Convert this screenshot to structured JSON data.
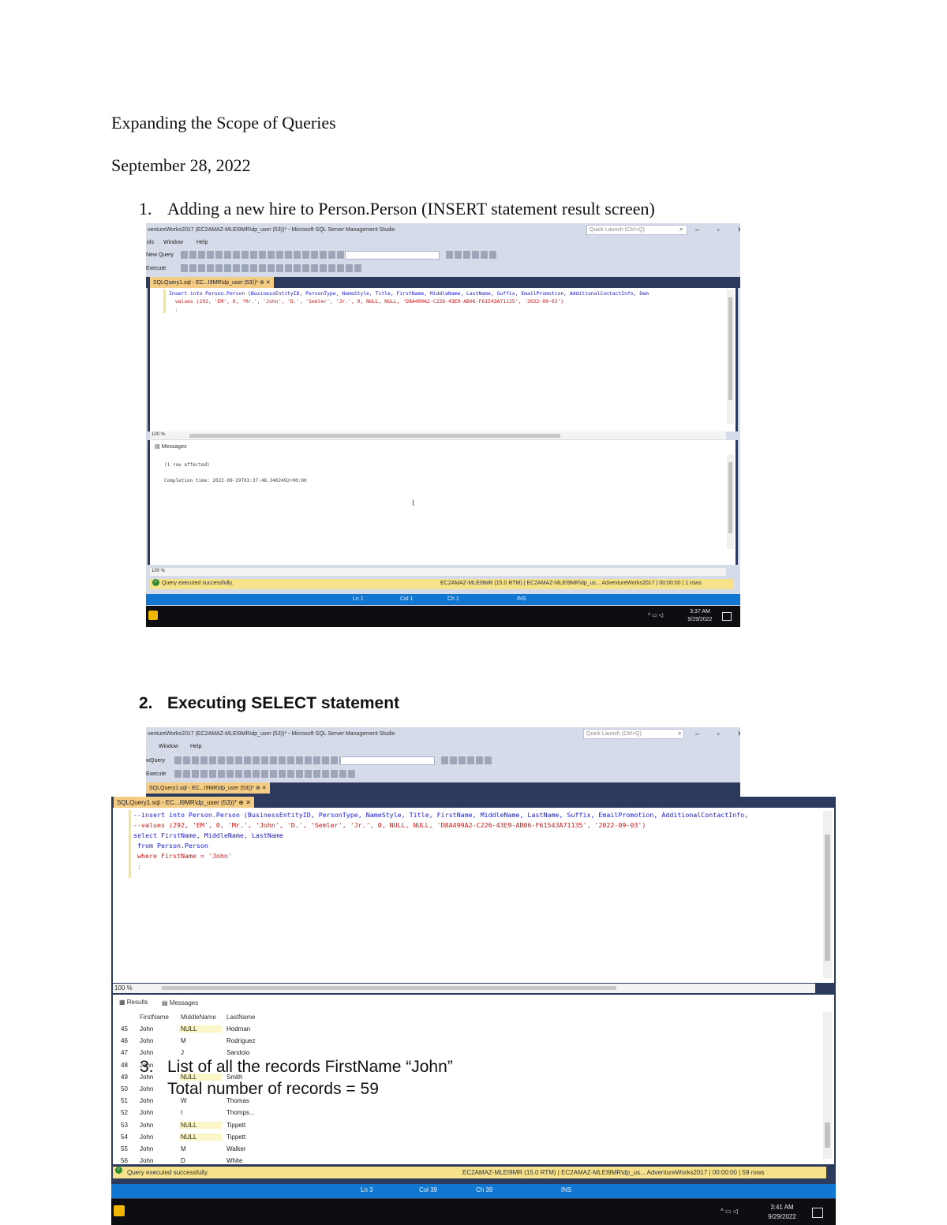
{
  "document": {
    "title": "Expanding the Scope of Queries",
    "date": "September 28, 2022",
    "item1": {
      "number": "1.",
      "text": "Adding a new hire to Person.Person (INSERT statement result screen)"
    },
    "item2": {
      "number": "2.",
      "text": "Executing SELECT statement"
    },
    "item3": {
      "number": "3.",
      "line1": "List of all the records FirstName “John”",
      "line2": "Total number of records = 59"
    }
  },
  "shot1": {
    "window_title": "ventureWorks2017 (EC2AMAZ-MLEI9MR\\dp_user (53))* - Microsoft SQL Server Management Studio",
    "quick_launch": "Quick Launch (Ctrl+Q)",
    "window_controls": "– ▫ ✕",
    "menu": [
      "ols",
      "Window",
      "Help"
    ],
    "toolbar1_label": "New Query",
    "toolbar2_label": "Execute",
    "tab": "SQLQuery1.sql - EC...I9MR\\dp_user (53))*  ⊕ ✕",
    "code": [
      "Insert into Person.Person (BusinessEntityID, PersonType, NameStyle, Title, FirstName, MiddleName, LastName, Suffix, EmailPromotion, AdditionalContactInfo, Dem",
      "  values (292, 'EM', 0, 'Mr.', 'John', 'D.', 'Semler', 'Jr.', 0, NULL, NULL, 'D8A499A2-C226-43E9-AB06-F61543A71135', '2022-09-03')",
      "  ;"
    ],
    "zoom": "100 %",
    "messages_tab": "Messages",
    "messages": [
      "(1 row affected)",
      "Completion time: 2022-09-29T03:37:48.3402492+00:00"
    ],
    "status_msg": "Query executed successfully.",
    "status_right": "EC2AMAZ-MLEI9MR (15.0 RTM)  | EC2AMAZ-MLEI9MR\\dp_us...  AdventureWorks2017  | 00:00:00 | 1 rows",
    "bluebar": {
      "ln": "Ln 1",
      "col": "Col 1",
      "ch": "Ch 1",
      "ins": "INS"
    },
    "clock_time": "3:37 AM",
    "clock_date": "9/29/2022"
  },
  "shot2": {
    "window_title": "ventureWorks2017 (EC2AMAZ-MLEI9MR\\dp_user (53))* - Microsoft SQL Server Management Studio",
    "quick_launch": "Quick Launch (Ctrl+Q)",
    "window_controls": "– ▫ ✕",
    "menu": [
      "",
      "Window",
      "Help"
    ],
    "toolbar1_label": "wQuery",
    "toolbar2_label": "Execute",
    "tab_back": "SQLQuery1.sql - EC...I9MR\\dp_user (53))*  ⊕ ✕",
    "tab_front": "SQLQuery1.sql - EC...I9MR\\dp_user (53))*  ⊕ ✕",
    "code": [
      "--insert into Person.Person (BusinessEntityID, PersonType, NameStyle, Title, FirstName, MiddleName, LastName, Suffix, EmailPromotion, AdditionalContactInfo,",
      "--values (292, 'EM', 0, 'Mr.', 'John', 'D.', 'Semler', 'Jr.', 0, NULL, NULL, 'D8A499A2-C226-43E9-AB06-F61543A71135', '2022-09-03')",
      "select FirstName, MiddleName, LastName",
      " from Person.Person",
      " where FirstName = 'John'",
      " ;"
    ],
    "zoom": "100 %",
    "results_tab": "Results",
    "messages_tab": "Messages",
    "columns": [
      "FirstName",
      "MiddleName",
      "LastName"
    ],
    "rows": [
      {
        "n": "45",
        "first": "John",
        "middle": "NULL",
        "last": "Hodman"
      },
      {
        "n": "46",
        "first": "John",
        "middle": "M",
        "last": "Rodriguez"
      },
      {
        "n": "47",
        "first": "John",
        "middle": "J",
        "last": "Sandoio"
      },
      {
        "n": "48",
        "first": "John",
        "middle": "",
        "last": ""
      },
      {
        "n": "49",
        "first": "John",
        "middle": "NULL",
        "last": "Smith"
      },
      {
        "n": "50",
        "first": "John",
        "middle": "",
        "last": ""
      },
      {
        "n": "51",
        "first": "John",
        "middle": "W",
        "last": "Thomas"
      },
      {
        "n": "52",
        "first": "John",
        "middle": "I",
        "last": "Thomps..."
      },
      {
        "n": "53",
        "first": "John",
        "middle": "NULL",
        "last": "Tippett"
      },
      {
        "n": "54",
        "first": "John",
        "middle": "NULL",
        "last": "Tippett"
      },
      {
        "n": "55",
        "first": "John",
        "middle": "M",
        "last": "Walker"
      },
      {
        "n": "56",
        "first": "John",
        "middle": "D",
        "last": "White"
      }
    ],
    "status_msg": "Query executed successfully.",
    "status_right": "EC2AMAZ-MLEI9MR (15.0 RTM)  | EC2AMAZ-MLEI9MR\\dp_us...  AdventureWorks2017  | 00:00:00  | 59 rows",
    "bluebar": {
      "ln": "Ln 3",
      "col": "Col 39",
      "ch": "Ch 39",
      "ins": "INS"
    },
    "clock_time": "3:41 AM",
    "clock_date": "9/29/2022"
  },
  "colors": {
    "ssms_chrome": "#d6dbe9",
    "ssms_navy": "#2c3a5e",
    "tab_gold": "#f5cc84",
    "status_blue": "#1177d1",
    "status_yellow": "#f6e28a"
  }
}
